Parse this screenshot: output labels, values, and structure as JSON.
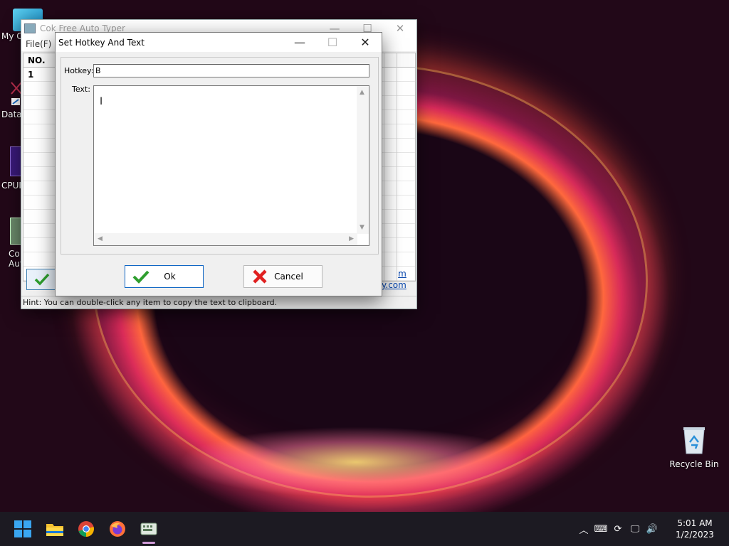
{
  "desktop": {
    "icons_left": [
      {
        "label": "My C",
        "icon": "computer-icon"
      },
      {
        "label": "DataV",
        "icon": "dataviz-icon"
      },
      {
        "label": "CPUI",
        "icon": "cpu-icon"
      },
      {
        "label": "Co Aut",
        "icon": "auto-typer-icon"
      }
    ],
    "recycle_bin": {
      "label": "Recycle Bin",
      "icon": "recycle-bin-icon"
    }
  },
  "app": {
    "title": "Cok Free Auto Typer",
    "menu_file": "File(F)",
    "grid": {
      "headers": [
        "NO."
      ],
      "rows": [
        [
          "1"
        ]
      ]
    },
    "links": [
      "m",
      "y.com"
    ],
    "hint": "Hint: You can double-click any item to copy the text to clipboard."
  },
  "dialog": {
    "title": "Set Hotkey And Text",
    "hotkey_label": "Hotkey:",
    "hotkey_value": "B",
    "text_label": "Text:",
    "text_value": "",
    "ok_label": "Ok",
    "cancel_label": "Cancel"
  },
  "taskbar": {
    "apps": [
      "start-icon",
      "file-explorer-icon",
      "chrome-icon",
      "firefox-icon",
      "auto-typer-icon"
    ],
    "clock_time": "5:01 AM",
    "clock_date": "1/2/2023"
  },
  "colors": {
    "accent": "#0f66c4",
    "link": "#0645ad",
    "ok_check": "#2e9e2e",
    "cancel_x": "#e02020"
  }
}
